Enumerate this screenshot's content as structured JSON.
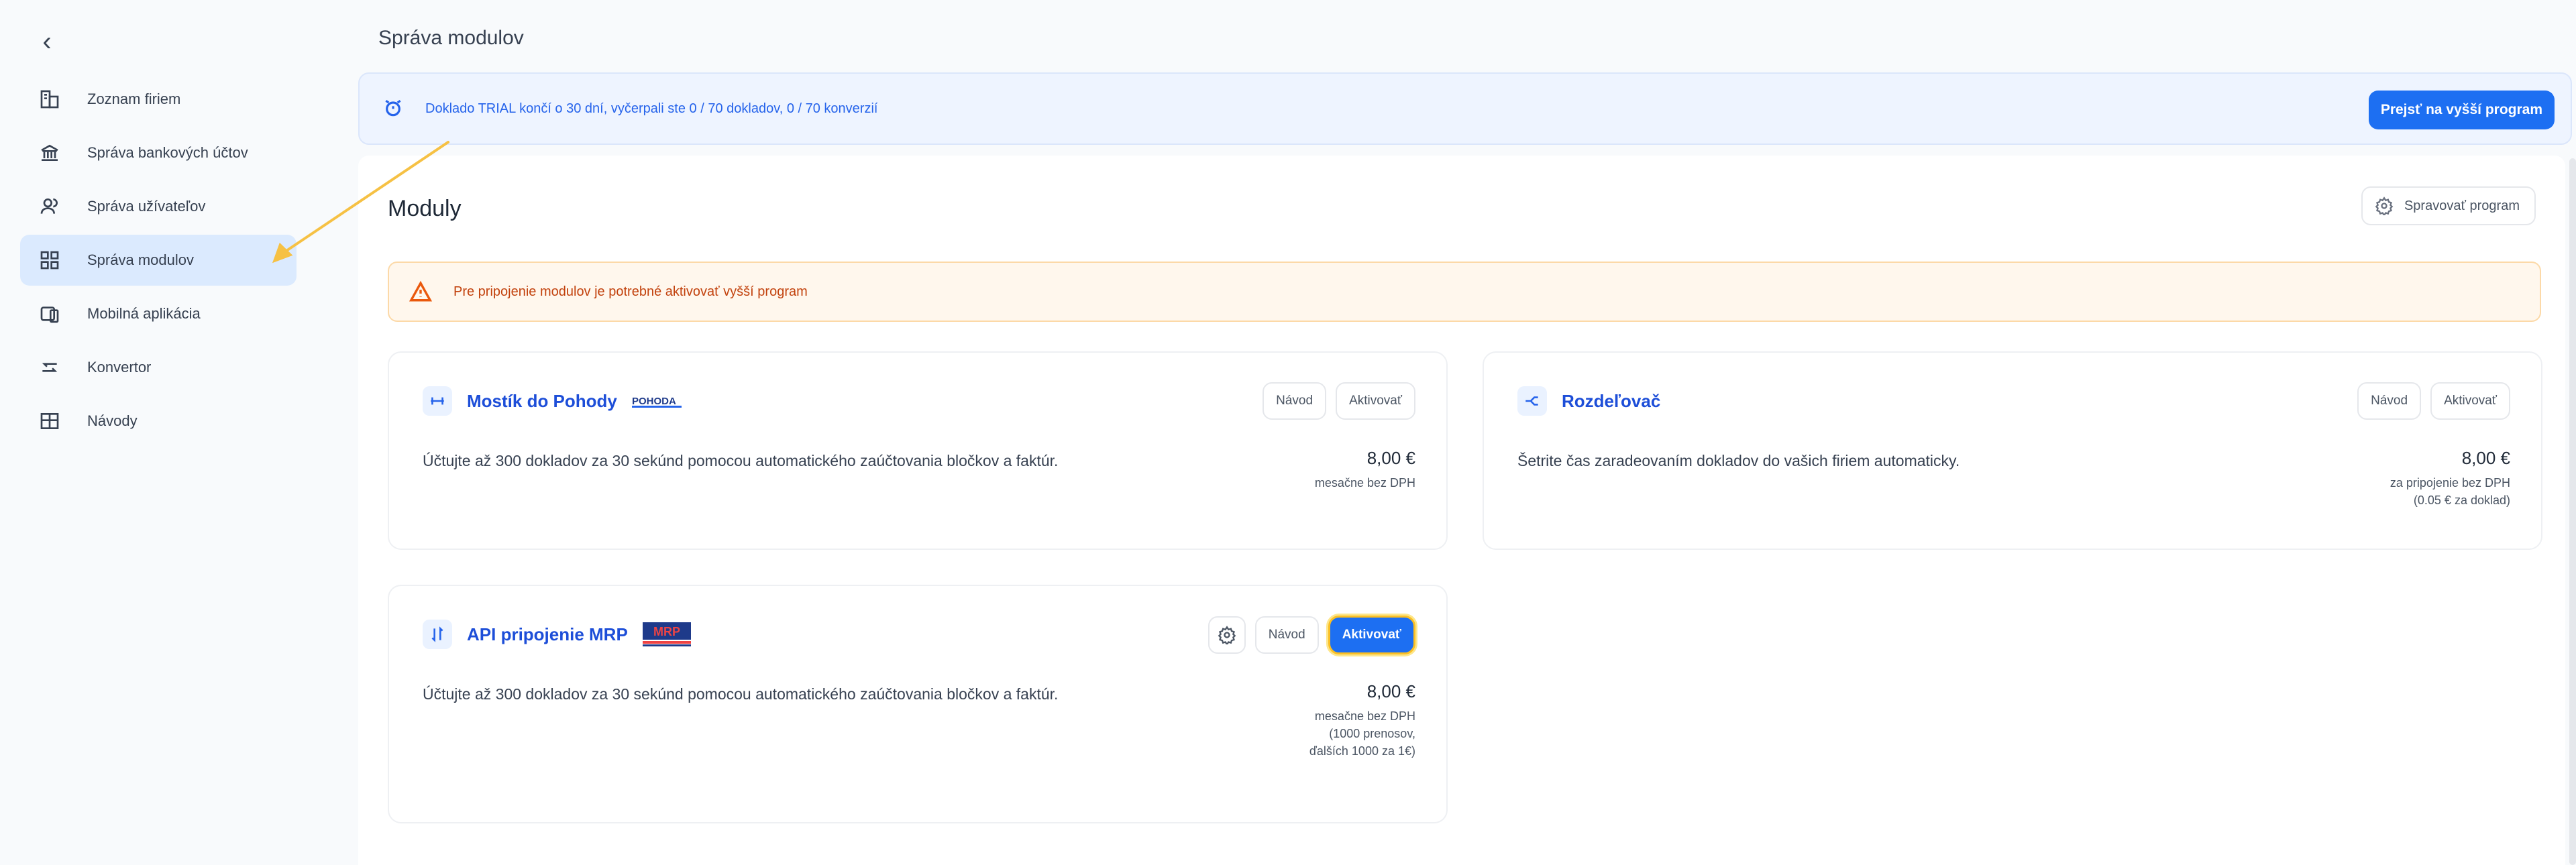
{
  "sidebar": {
    "back_icon": "chevron-left-icon",
    "items": [
      {
        "label": "Zoznam firiem",
        "icon": "building-icon"
      },
      {
        "label": "Správa bankových účtov",
        "icon": "bank-icon"
      },
      {
        "label": "Správa užívateľov",
        "icon": "users-icon"
      },
      {
        "label": "Správa modulov",
        "icon": "modules-icon",
        "active": true
      },
      {
        "label": "Mobilná aplikácia",
        "icon": "mobile-icon"
      },
      {
        "label": "Konvertor",
        "icon": "convert-icon"
      },
      {
        "label": "Návody",
        "icon": "book-icon"
      }
    ]
  },
  "header": {
    "title": "Správa modulov"
  },
  "trial_banner": {
    "text": "Doklado TRIAL končí o 30 dní, vyčerpali ste 0 / 70 dokladov, 0 / 70 konverzií",
    "button_label": "Prejsť na vyšší program",
    "icon": "alarm-clock-icon"
  },
  "modules_section": {
    "title": "Moduly",
    "manage_label": "Spravovať program",
    "warning": "Pre pripojenie modulov je potrebné aktivovať vyšší program"
  },
  "cards": [
    {
      "title": "Mostík do Pohody",
      "logo_text": "POHODA",
      "description": "Účtujte až 300 dokladov za 30 sekúnd pomocou automatického zaúčtovania bločkov a faktúr.",
      "price": "8,00 €",
      "price_note": "mesačne bez DPH",
      "guide_label": "Návod",
      "activate_label": "Aktivovať"
    },
    {
      "title": "Rozdeľovač",
      "description": "Šetrite čas zaradeovaním dokladov do vašich firiem automaticky.",
      "price": "8,00 €",
      "price_note_1": "za pripojenie bez DPH",
      "price_note_2": "(0.05 € za doklad)",
      "guide_label": "Návod",
      "activate_label": "Aktivovať"
    },
    {
      "title": "API pripojenie MRP",
      "logo_text": "MRP",
      "description": "Účtujte až 300 dokladov za 30 sekúnd pomocou automatického zaúčtovania bločkov a faktúr.",
      "price": "8,00 €",
      "price_note_1": "mesačne bez DPH",
      "price_note_2": "(1000 prenosov,",
      "price_note_3": "ďalších 1000 za 1€)",
      "guide_label": "Návod",
      "activate_label": "Aktivovať"
    }
  ],
  "colors": {
    "accent": "#1d6ff2",
    "active_nav": "#dbeafe",
    "warning_bg": "#fff7ed",
    "annotation": "#f6c144"
  }
}
